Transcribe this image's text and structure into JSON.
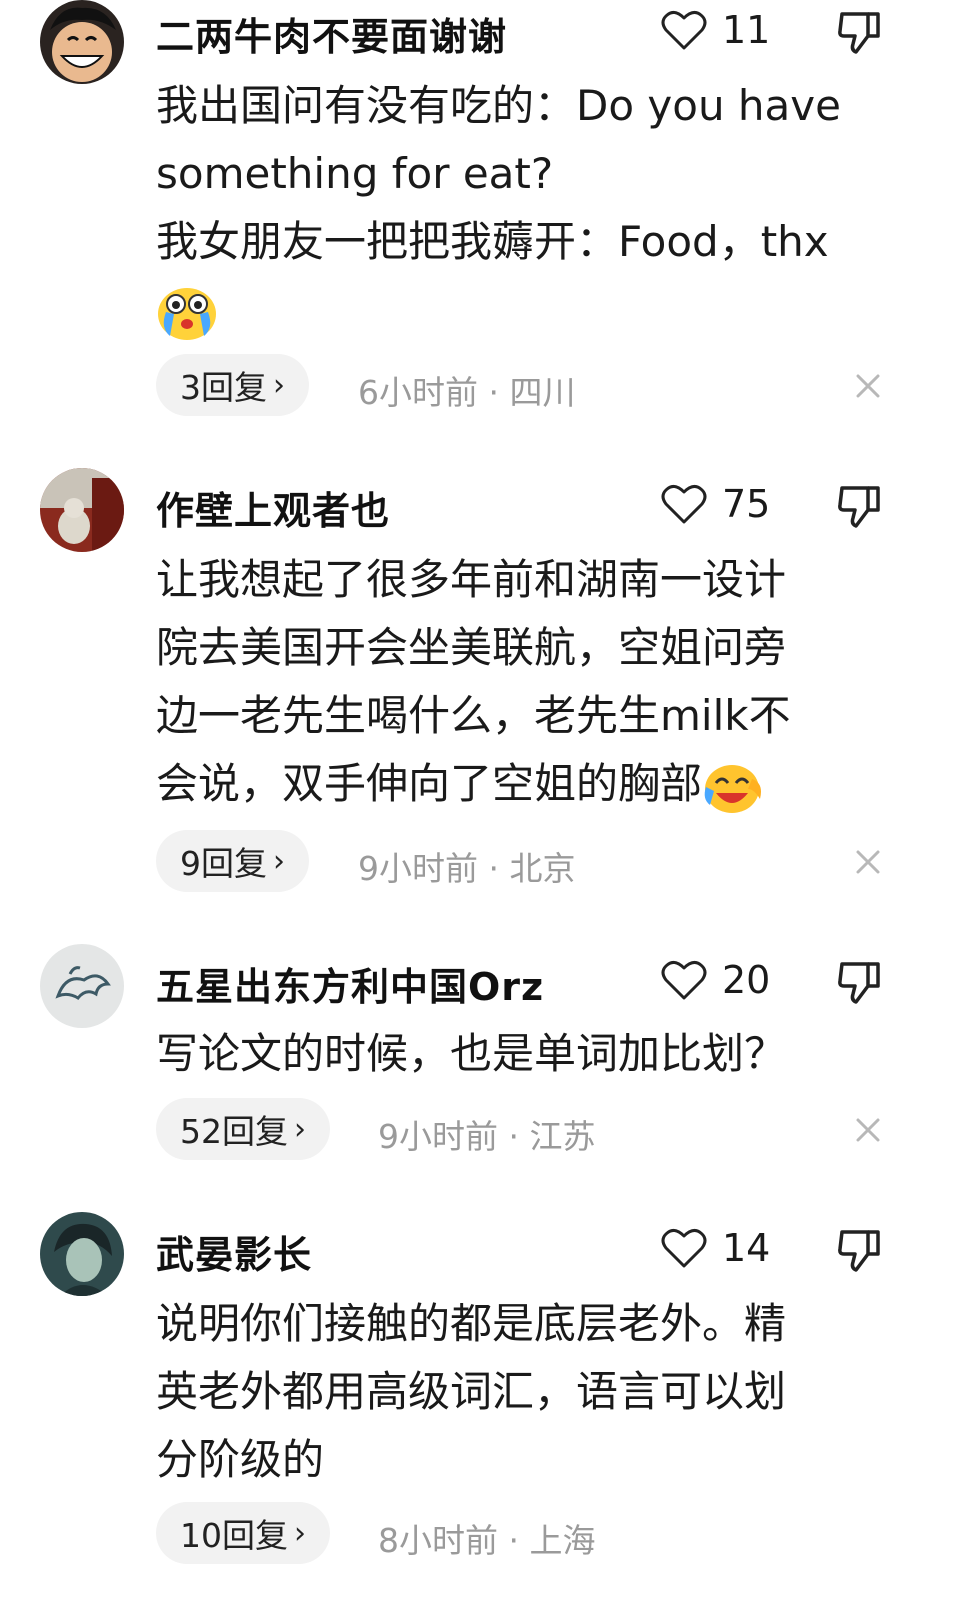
{
  "comments": [
    {
      "username": "二两牛肉不要面谢谢",
      "likes": "11",
      "lines": [
        "我出国问有没有吃的：Do you have",
        "something for eat?",
        "我女朋友一把把我薅开：Food，thx"
      ],
      "emoji": "crying-face-emoji",
      "replies": "3回复",
      "meta": "6小时前 · 四川"
    },
    {
      "username": "作壁上观者也",
      "likes": "75",
      "lines": [
        "让我想起了很多年前和湖南一设计",
        "院去美国开会坐美联航，空姐问旁",
        "边一老先生喝什么，老先生milk不",
        "会说，双手伸向了空姐的胸部"
      ],
      "emoji": "laughing-face-emoji",
      "replies": "9回复",
      "meta": "9小时前 · 北京"
    },
    {
      "username": "五星出东方利中国Orz",
      "likes": "20",
      "lines": [
        "写论文的时候，也是单词加比划？"
      ],
      "replies": "52回复",
      "meta": "9小时前 · 江苏"
    },
    {
      "username": "武晏影长",
      "likes": "14",
      "lines": [
        "说明你们接触的都是底层老外。精",
        "英老外都用高级词汇，语言可以划",
        "分阶级的"
      ],
      "replies": "10回复",
      "meta": "8小时前 · 上海"
    }
  ],
  "icons": {
    "like": "heart-outline-icon",
    "dislike": "thumbs-down-icon",
    "close": "close-icon",
    "chevron": "chevron-right-icon"
  },
  "colors": {
    "meta_text": "#9a9a9a",
    "pill_bg": "#f2f2f2"
  }
}
